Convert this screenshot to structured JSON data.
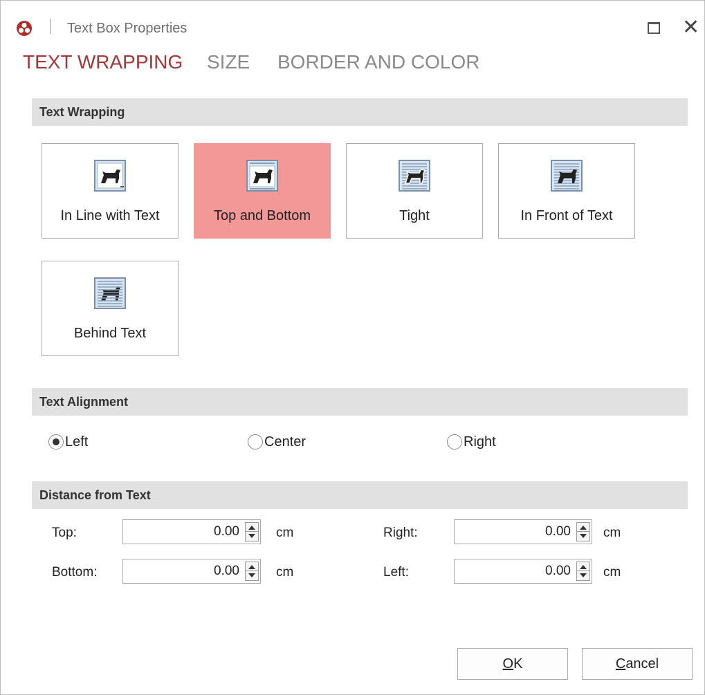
{
  "window": {
    "title": "Text Box Properties",
    "maximize_icon": "maximize-icon",
    "close_icon": "close-icon"
  },
  "tabs": [
    {
      "label": "TEXT WRAPPING",
      "active": true
    },
    {
      "label": "SIZE",
      "active": false
    },
    {
      "label": "BORDER AND COLOR",
      "active": false
    }
  ],
  "wrapping": {
    "header": "Text Wrapping",
    "options": [
      {
        "label": "In Line with Text",
        "icon": "inline-wrap-icon",
        "selected": false
      },
      {
        "label": "Top and Bottom",
        "icon": "top-bottom-wrap-icon",
        "selected": true
      },
      {
        "label": "Tight",
        "icon": "tight-wrap-icon",
        "selected": false
      },
      {
        "label": "In Front of Text",
        "icon": "in-front-wrap-icon",
        "selected": false
      },
      {
        "label": "Behind Text",
        "icon": "behind-wrap-icon",
        "selected": false
      }
    ]
  },
  "alignment": {
    "header": "Text Alignment",
    "options": [
      {
        "label": "Left",
        "checked": true
      },
      {
        "label": "Center",
        "checked": false
      },
      {
        "label": "Right",
        "checked": false
      }
    ]
  },
  "distance": {
    "header": "Distance from Text",
    "top": {
      "label": "Top:",
      "value": "0.00",
      "unit": "cm"
    },
    "bottom": {
      "label": "Bottom:",
      "value": "0.00",
      "unit": "cm"
    },
    "right": {
      "label": "Right:",
      "value": "0.00",
      "unit": "cm"
    },
    "left": {
      "label": "Left:",
      "value": "0.00",
      "unit": "cm"
    }
  },
  "buttons": {
    "ok_mnemonic": "O",
    "ok_rest": "K",
    "cancel_mnemonic": "C",
    "cancel_rest": "ancel"
  },
  "colors": {
    "accent": "#a4373a",
    "selected_tile": "#f39797",
    "section_bg": "#e1e1e1"
  }
}
